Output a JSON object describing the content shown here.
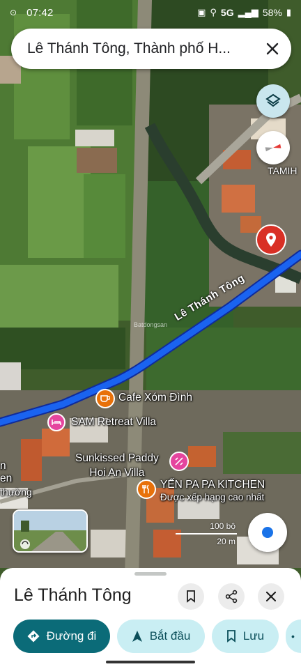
{
  "status_bar": {
    "time": "07:42",
    "network": "5G",
    "battery": "58%"
  },
  "search": {
    "query": "Lê Thánh Tông, Thành phố H..."
  },
  "map": {
    "road_name": "Lê Thánh Tông",
    "area_label": "TAMIH",
    "watermark": "Batdongsan",
    "places": [
      {
        "name": "Cafe Xóm Đình",
        "icon": "coffee-icon",
        "color": "#e8710a"
      },
      {
        "name": "SAM Retreat Villa",
        "icon": "bed-icon",
        "color": "#e5459e"
      },
      {
        "name": "Sunkissed Paddy\nHoi An Villa",
        "icon": "hotel-icon",
        "color": "#e5459e"
      },
      {
        "name": "YẾN PA PA KITCHEN",
        "subtitle": "Được xếp hạng cao nhất",
        "icon": "restaurant-icon",
        "color": "#e8710a"
      }
    ],
    "edge_text_1": "n",
    "edge_text_2": "en",
    "edge_text_3": "thường",
    "scale": {
      "imperial": "100 bộ",
      "metric": "20 m"
    },
    "accent_color": "#1a63f0",
    "pin_color": "#d93025"
  },
  "sheet": {
    "title": "Lê Thánh Tông",
    "actions": [
      {
        "label": "Đường đi",
        "icon": "directions-icon"
      },
      {
        "label": "Bắt đầu",
        "icon": "navigation-icon"
      },
      {
        "label": "Lưu",
        "icon": "bookmark-icon"
      }
    ],
    "brand_color": "#0b6b78"
  }
}
